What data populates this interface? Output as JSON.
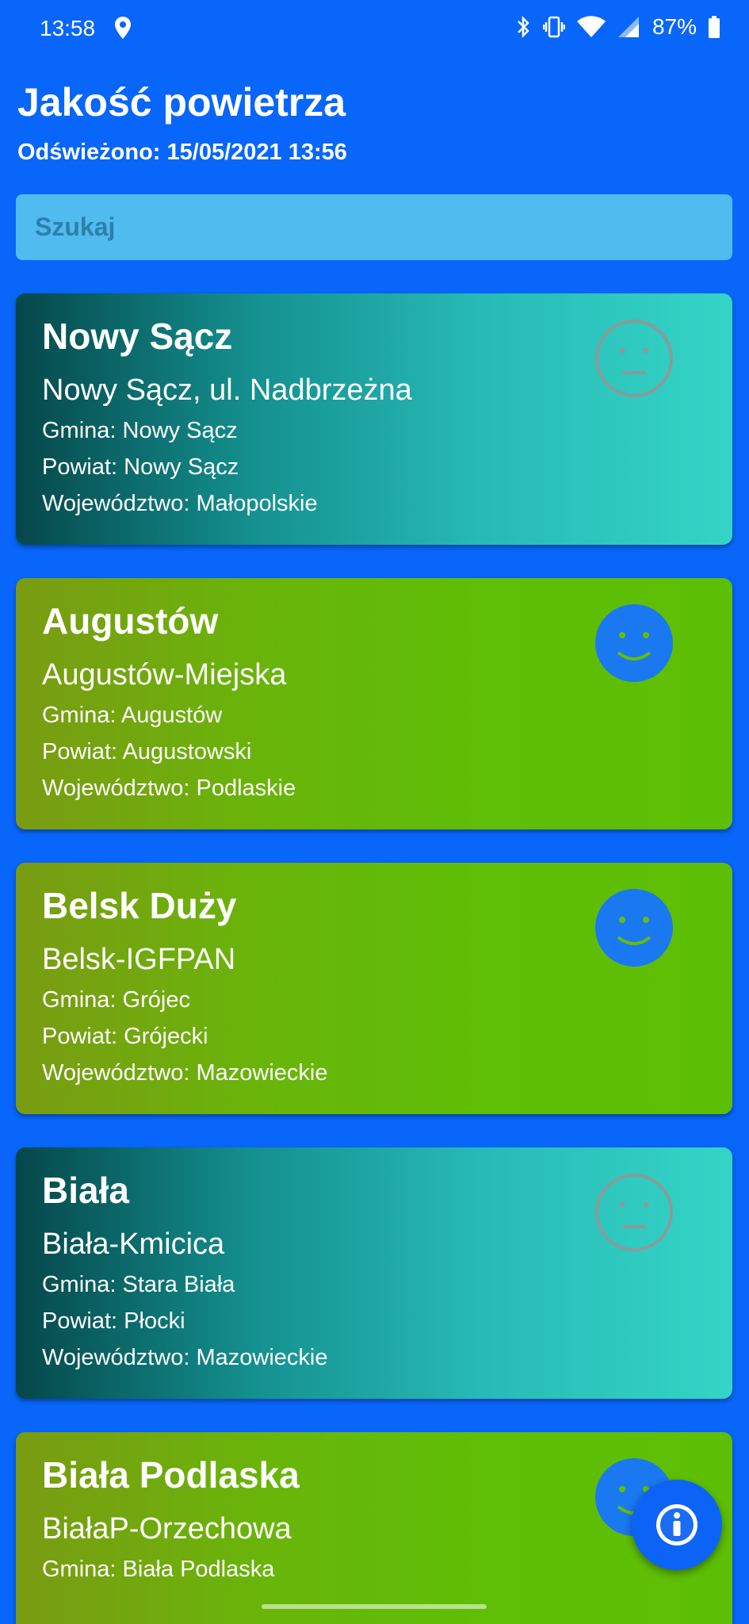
{
  "status_bar": {
    "time": "13:58",
    "battery_percent": "87%",
    "icons": [
      "location-icon",
      "bluetooth-icon",
      "vibrate-icon",
      "wifi-icon",
      "cellular-signal-icon",
      "battery-icon"
    ]
  },
  "header": {
    "title": "Jakość powietrza",
    "refreshed": "Odświeżono: 15/05/2021 13:56"
  },
  "search": {
    "placeholder": "Szukaj",
    "value": ""
  },
  "stations": [
    {
      "city": "Nowy Sącz",
      "station": "Nowy Sącz, ul. Nadbrzeżna",
      "gmina": "Gmina: Nowy Sącz",
      "powiat": "Powiat: Nowy Sącz",
      "wojewodztwo": "Województwo: Małopolskie",
      "rating": "neutral",
      "face_icon": "neutral-face-icon"
    },
    {
      "city": "Augustów",
      "station": "Augustów-Miejska",
      "gmina": "Gmina: Augustów",
      "powiat": "Powiat: Augustowski",
      "wojewodztwo": "Województwo: Podlaskie",
      "rating": "good",
      "face_icon": "smiley-face-icon"
    },
    {
      "city": "Belsk Duży",
      "station": "Belsk-IGFPAN",
      "gmina": "Gmina: Grójec",
      "powiat": "Powiat: Grójecki",
      "wojewodztwo": "Województwo: Mazowieckie",
      "rating": "good",
      "face_icon": "smiley-face-icon"
    },
    {
      "city": "Biała",
      "station": "Biała-Kmicica",
      "gmina": "Gmina: Stara Biała",
      "powiat": "Powiat: Płocki",
      "wojewodztwo": "Województwo: Mazowieckie",
      "rating": "neutral",
      "face_icon": "neutral-face-icon"
    },
    {
      "city": "Biała Podlaska",
      "station": "BiałaP-Orzechowa",
      "gmina": "Gmina: Biała Podlaska",
      "powiat": "",
      "wojewodztwo": "",
      "rating": "good",
      "face_icon": "smiley-face-icon"
    }
  ],
  "fab": {
    "icon": "info-icon"
  },
  "colors": {
    "background": "#0866fa",
    "search_bg": "#50bbee",
    "neutral_card_start": "#05474a",
    "neutral_card_end": "#34d4c6",
    "good_card_start": "#7a9b12",
    "good_card_end": "#5dbf05",
    "smiley_fill": "#1a78f0",
    "neutral_face_stroke": "#8c9a9a"
  }
}
